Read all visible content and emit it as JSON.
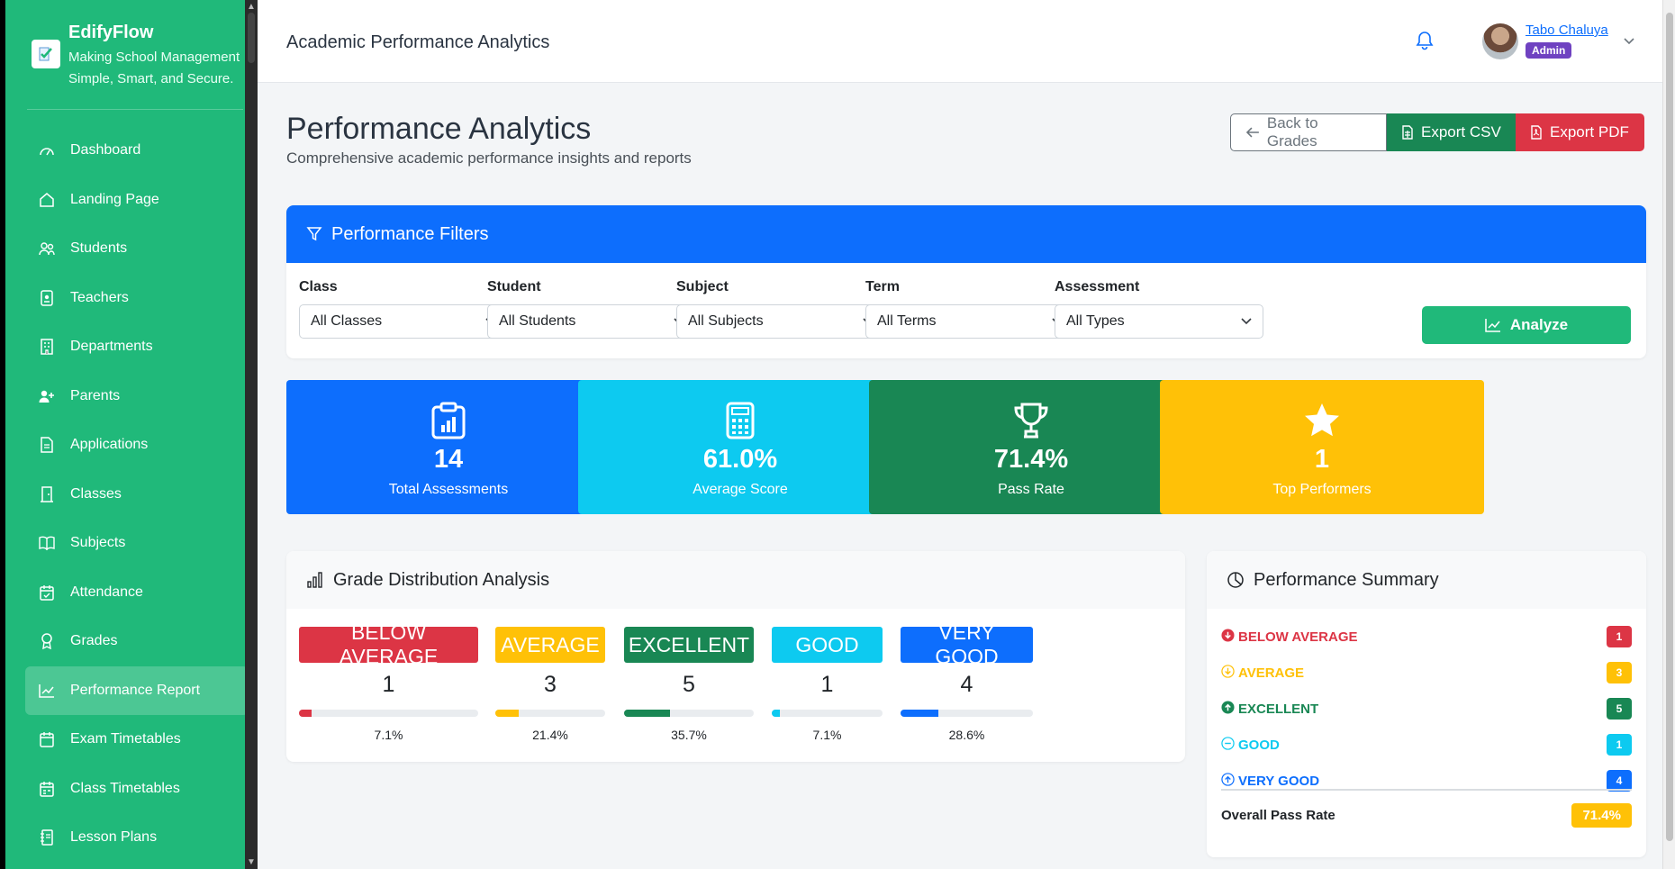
{
  "brand": {
    "name": "EdifyFlow",
    "tagline": "Making School Management Simple, Smart, and Secure."
  },
  "sidebar": {
    "items": [
      {
        "label": "Dashboard",
        "icon": "gauge-icon"
      },
      {
        "label": "Landing Page",
        "icon": "home-icon"
      },
      {
        "label": "Students",
        "icon": "users-icon"
      },
      {
        "label": "Teachers",
        "icon": "id-badge-icon"
      },
      {
        "label": "Departments",
        "icon": "building-icon"
      },
      {
        "label": "Parents",
        "icon": "user-plus-icon"
      },
      {
        "label": "Applications",
        "icon": "file-icon"
      },
      {
        "label": "Classes",
        "icon": "door-icon"
      },
      {
        "label": "Subjects",
        "icon": "book-icon"
      },
      {
        "label": "Attendance",
        "icon": "calendar-check-icon"
      },
      {
        "label": "Grades",
        "icon": "award-icon"
      },
      {
        "label": "Performance Report",
        "icon": "chart-line-icon",
        "active": true
      },
      {
        "label": "Exam Timetables",
        "icon": "calendar-icon"
      },
      {
        "label": "Class Timetables",
        "icon": "calendar-week-icon"
      },
      {
        "label": "Lesson Plans",
        "icon": "journal-icon"
      }
    ]
  },
  "topbar": {
    "title": "Academic Performance Analytics",
    "user_name": "Tabo Chaluya",
    "user_role": "Admin"
  },
  "page": {
    "title": "Performance Analytics",
    "subtitle": "Comprehensive academic performance insights and reports"
  },
  "actions": {
    "back": "Back to Grades",
    "csv": "Export CSV",
    "pdf": "Export PDF"
  },
  "filters": {
    "heading": "Performance Filters",
    "fields": [
      {
        "label": "Class",
        "value": "All Classes"
      },
      {
        "label": "Student",
        "value": "All Students"
      },
      {
        "label": "Subject",
        "value": "All Subjects"
      },
      {
        "label": "Term",
        "value": "All Terms"
      },
      {
        "label": "Assessment",
        "value": "All Types"
      }
    ],
    "analyze": "Analyze"
  },
  "stats": [
    {
      "value": "14",
      "label": "Total Assessments",
      "color": "#0d6efd",
      "icon": "clipboard-chart-icon"
    },
    {
      "value": "61.0%",
      "label": "Average Score",
      "color": "#0dcaf0",
      "icon": "calculator-icon"
    },
    {
      "value": "71.4%",
      "label": "Pass Rate",
      "color": "#198754",
      "icon": "trophy-icon"
    },
    {
      "value": "1",
      "label": "Top Performers",
      "color": "#ffc107",
      "icon": "star-icon"
    }
  ],
  "distribution": {
    "heading": "Grade Distribution Analysis",
    "grades": [
      {
        "label": "BELOW AVERAGE",
        "count": "1",
        "pct": "7.1%",
        "fraction": 0.071,
        "color": "#dc3545"
      },
      {
        "label": "AVERAGE",
        "count": "3",
        "pct": "21.4%",
        "fraction": 0.214,
        "color": "#ffc107"
      },
      {
        "label": "EXCELLENT",
        "count": "5",
        "pct": "35.7%",
        "fraction": 0.357,
        "color": "#198754"
      },
      {
        "label": "GOOD",
        "count": "1",
        "pct": "7.1%",
        "fraction": 0.071,
        "color": "#0dcaf0"
      },
      {
        "label": "VERY GOOD",
        "count": "4",
        "pct": "28.6%",
        "fraction": 0.286,
        "color": "#0d6efd"
      }
    ]
  },
  "summary": {
    "heading": "Performance Summary",
    "rows": [
      {
        "label": "BELOW AVERAGE",
        "count": "1",
        "color": "#dc3545",
        "icon": "arrow-down-circle-icon"
      },
      {
        "label": "AVERAGE",
        "count": "3",
        "color": "#ffc107",
        "icon": "arrow-down-circle-outline-icon"
      },
      {
        "label": "EXCELLENT",
        "count": "5",
        "color": "#198754",
        "icon": "arrow-up-circle-icon"
      },
      {
        "label": "GOOD",
        "count": "1",
        "color": "#0dcaf0",
        "icon": "dash-circle-icon"
      },
      {
        "label": "VERY GOOD",
        "count": "4",
        "color": "#0d6efd",
        "icon": "arrow-up-circle-outline-icon"
      }
    ],
    "overall_label": "Overall Pass Rate",
    "overall_value": "71.4%"
  }
}
